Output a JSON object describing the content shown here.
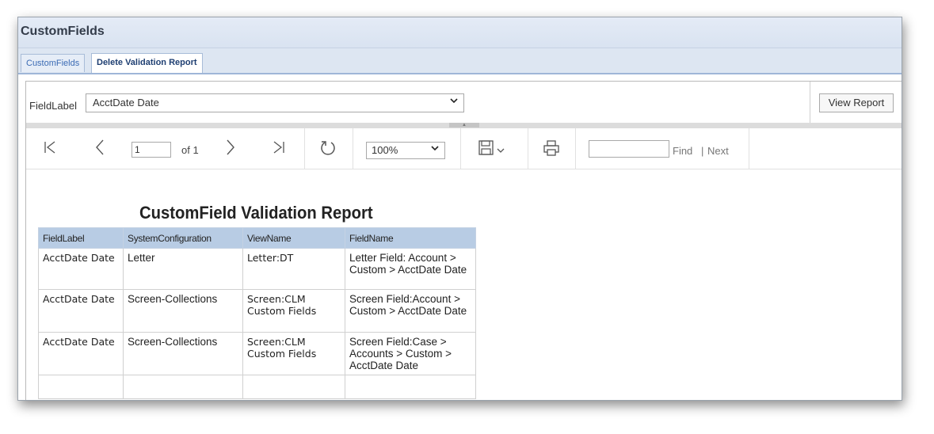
{
  "window": {
    "title": "CustomFields"
  },
  "tabs": [
    {
      "label": "CustomFields",
      "active": false
    },
    {
      "label": "Delete Validation Report",
      "active": true
    }
  ],
  "parameters": {
    "label": "FieldLabel",
    "selected_value": "AcctDate Date",
    "view_report_label": "View Report"
  },
  "toolbar": {
    "first_page_icon": "first-page-icon",
    "prev_page_icon": "prev-page-icon",
    "page_value": "1",
    "of_text": "of 1",
    "next_page_icon": "next-page-icon",
    "last_page_icon": "last-page-icon",
    "refresh_icon": "refresh-icon",
    "zoom_value": "100%",
    "save_icon": "save-icon",
    "print_icon": "print-icon",
    "find_value": "",
    "find_label": "Find",
    "separator": "|",
    "next_label": "Next"
  },
  "report": {
    "title": "CustomField Validation Report",
    "headers": [
      "FieldLabel",
      "SystemConfiguration",
      "ViewName",
      "FieldName"
    ],
    "rows": [
      [
        "AcctDate Date",
        "Letter",
        "Letter:DT",
        "Letter Field: Account > Custom > AcctDate Date"
      ],
      [
        "AcctDate Date",
        "Screen-Collections",
        "Screen:CLM Custom Fields",
        "Screen Field:Account > Custom > AcctDate Date"
      ],
      [
        "AcctDate Date",
        "Screen-Collections",
        "Screen:CLM Custom Fields",
        "Screen Field:Case > Accounts > Custom > AcctDate Date"
      ]
    ]
  },
  "colors": {
    "header_bg": "#b8cce4",
    "titlebar_bg": "#dde6f2",
    "active_tab_text": "#1f3f72",
    "inactive_tab_text": "#3b6bb4"
  }
}
